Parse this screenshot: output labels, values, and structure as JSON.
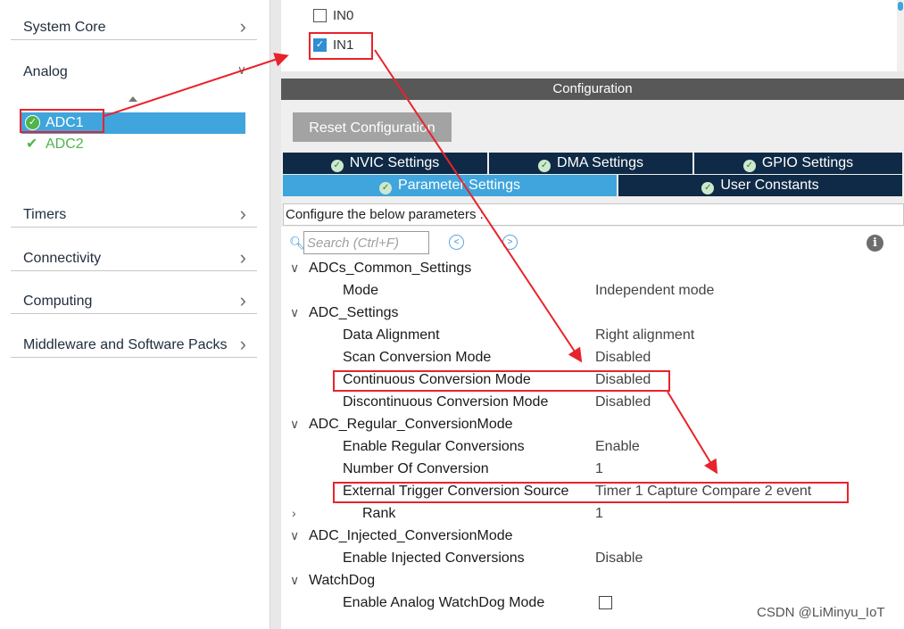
{
  "categories": {
    "system_core": "System Core",
    "analog": "Analog",
    "timers": "Timers",
    "connectivity": "Connectivity",
    "computing": "Computing",
    "middleware": "Middleware and Software Packs"
  },
  "analog_items": [
    "ADC1",
    "ADC2"
  ],
  "channels": [
    {
      "label": "IN0",
      "checked": false
    },
    {
      "label": "IN1",
      "checked": true
    }
  ],
  "configuration": {
    "header": "Configuration",
    "reset_button": "Reset Configuration",
    "tabs_row1": [
      "NVIC Settings",
      "DMA Settings",
      "GPIO Settings"
    ],
    "tabs_row2": [
      "Parameter Settings",
      "User Constants"
    ],
    "active_tab": "Parameter Settings",
    "description": "Configure the below parameters :",
    "search_placeholder": "Search (Ctrl+F)"
  },
  "parameters": [
    {
      "type": "group",
      "expanded": true,
      "label": "ADCs_Common_Settings"
    },
    {
      "type": "item",
      "name": "Mode",
      "value": "Independent mode"
    },
    {
      "type": "group",
      "expanded": true,
      "label": "ADC_Settings"
    },
    {
      "type": "item",
      "name": "Data Alignment",
      "value": "Right alignment"
    },
    {
      "type": "item",
      "name": "Scan Conversion Mode",
      "value": "Disabled"
    },
    {
      "type": "item",
      "name": "Continuous Conversion Mode",
      "value": "Disabled"
    },
    {
      "type": "item",
      "name": "Discontinuous Conversion Mode",
      "value": "Disabled"
    },
    {
      "type": "group",
      "expanded": true,
      "label": "ADC_Regular_ConversionMode"
    },
    {
      "type": "item",
      "name": "Enable Regular Conversions",
      "value": "Enable"
    },
    {
      "type": "item",
      "name": "Number Of Conversion",
      "value": "1"
    },
    {
      "type": "item",
      "name": "External Trigger Conversion Source",
      "value": "Timer 1 Capture Compare 2 event"
    },
    {
      "type": "subgroup",
      "expanded": false,
      "name": "Rank",
      "value": "1"
    },
    {
      "type": "group",
      "expanded": true,
      "label": "ADC_Injected_ConversionMode"
    },
    {
      "type": "item",
      "name": "Enable Injected Conversions",
      "value": "Disable"
    },
    {
      "type": "group",
      "expanded": true,
      "label": "WatchDog"
    },
    {
      "type": "item",
      "name": "Enable Analog WatchDog Mode",
      "checkbox": false
    }
  ],
  "watermark": "CSDN @LiMinyu_IoT",
  "colors": {
    "selection": "#3fa5dc",
    "tab_dark": "#0f2a46",
    "check_green": "#4fb54a",
    "annotation_red": "#e8232b"
  },
  "icons": {
    "chevron": "›",
    "expanded": "∨",
    "collapsed": "›",
    "search": "search-icon",
    "info": "info-icon"
  }
}
